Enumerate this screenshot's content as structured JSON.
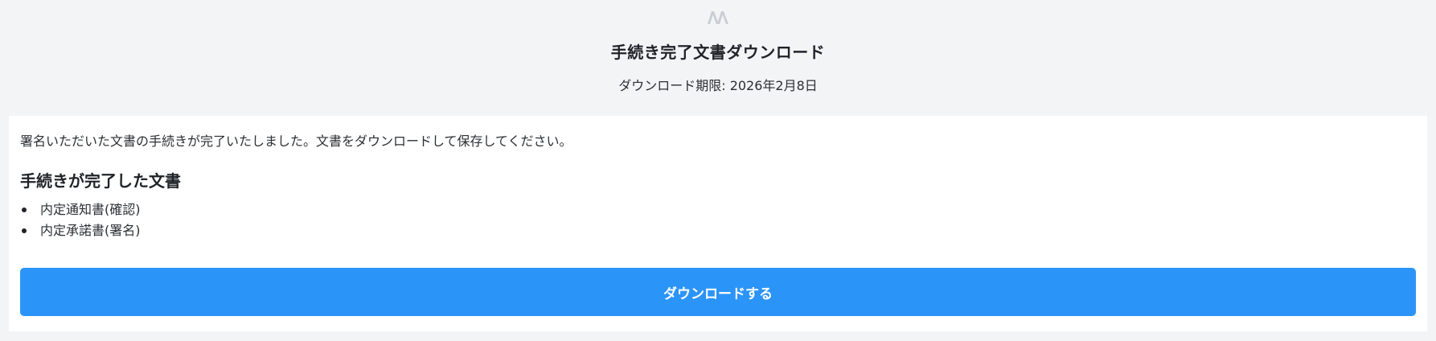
{
  "header": {
    "logo_icon": "brand-logo-icon",
    "title": "手続き完了文書ダウンロード",
    "deadline": "ダウンロード期限: 2026年2月8日"
  },
  "main": {
    "intro": "署名いただいた文書の手続きが完了いたしました。文書をダウンロードして保存してください。",
    "section_title": "手続きが完了した文書",
    "documents": [
      "内定通知書(確認)",
      "内定承諾書(署名)"
    ],
    "download_label": "ダウンロードする"
  },
  "colors": {
    "background": "#f3f4f6",
    "card": "#ffffff",
    "button": "#2b94f8",
    "logo": "#c9ced4"
  }
}
